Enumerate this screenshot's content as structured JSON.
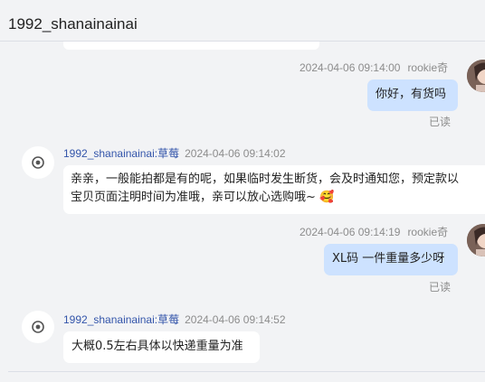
{
  "conversation": {
    "title": "1992_shanainainai"
  },
  "messages": [
    {
      "direction": "outgoing",
      "timestamp": "2024-04-06 09:14:00",
      "sender": "rookie奇",
      "text": "你好，有货吗",
      "status": "已读"
    },
    {
      "direction": "incoming",
      "sender": "1992_shanainainai:草莓",
      "timestamp": "2024-04-06 09:14:02",
      "lines": [
        "亲亲，一般能拍都是有的呢，如果临时发生断货，会及时通知您，预定款以",
        "宝贝页面注明时间为准哦，亲可以放心选购哦~ 🥰"
      ]
    },
    {
      "direction": "outgoing",
      "timestamp": "2024-04-06 09:14:19",
      "sender": "rookie奇",
      "text": "XL码 一件重量多少呀",
      "status": "已读"
    },
    {
      "direction": "incoming",
      "sender": "1992_shanainainai:草莓",
      "timestamp": "2024-04-06 09:14:52",
      "text": "大概0.5左右具体以快递重量为准"
    }
  ],
  "icons": {
    "customer_avatar": "user-photo-avatar",
    "shop_avatar": "shop-logo-avatar"
  },
  "colors": {
    "outgoing_bubble": "#cde2ff",
    "incoming_bubble": "#ffffff",
    "background": "#f2f3f5",
    "sender_link": "#3355aa"
  }
}
